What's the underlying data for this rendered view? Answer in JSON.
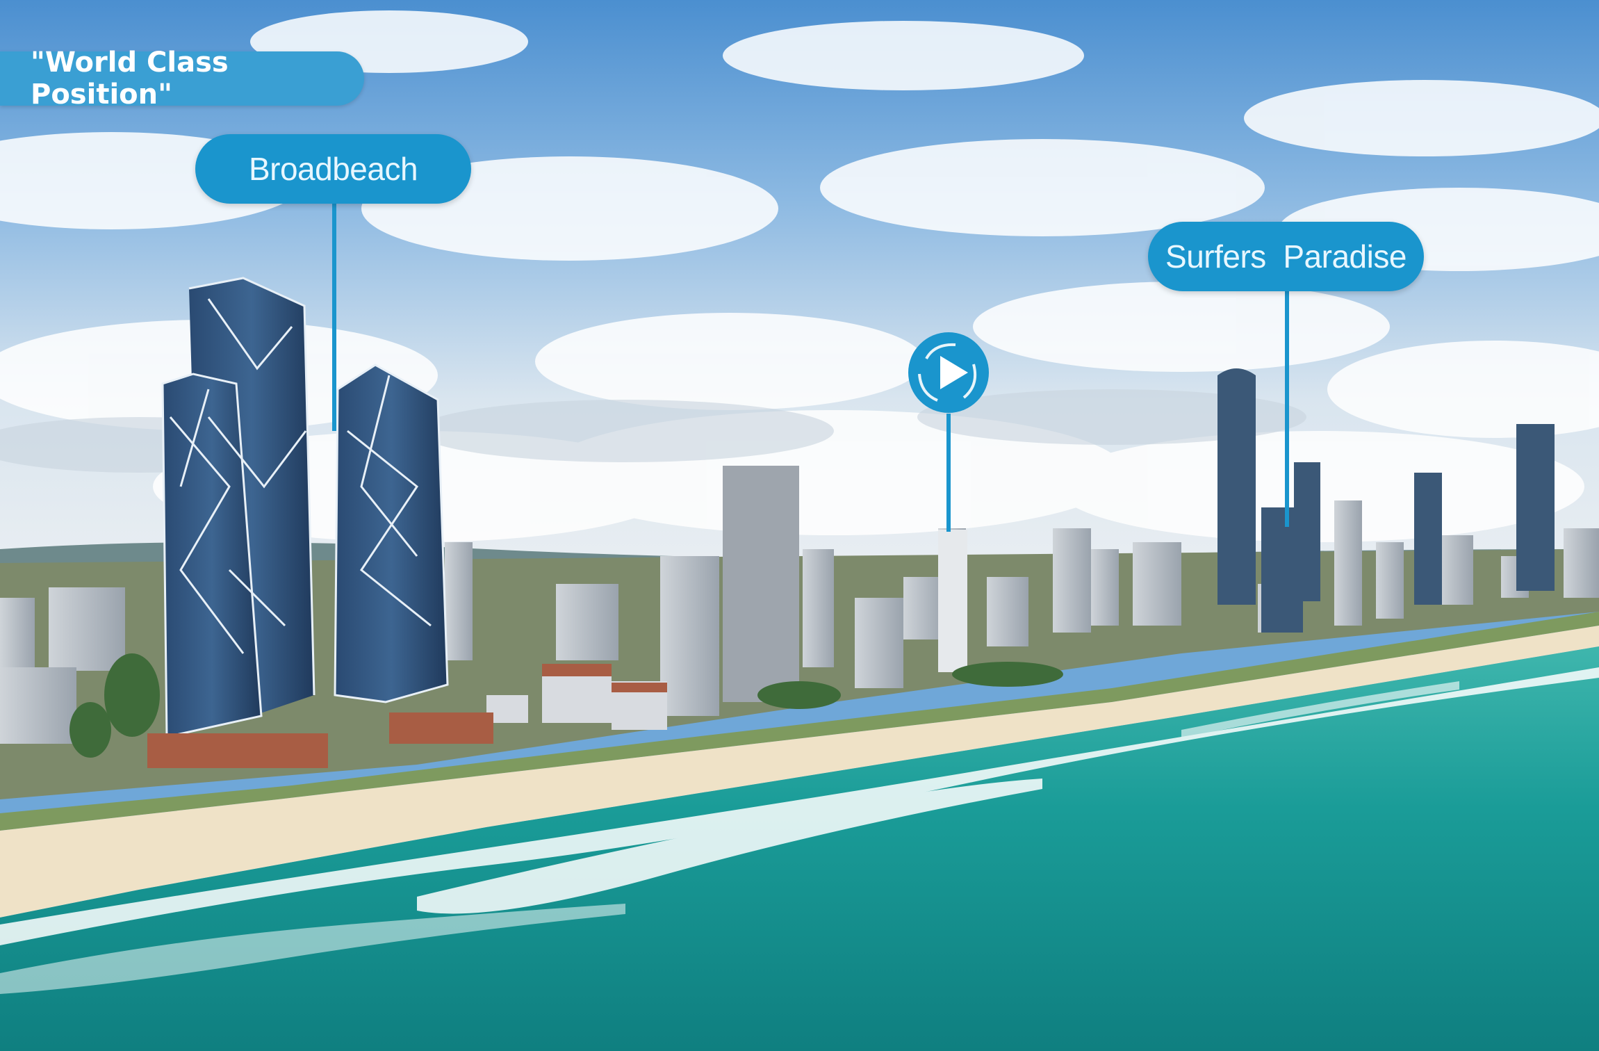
{
  "banner": {
    "title": "\"World Class Position\""
  },
  "markers": {
    "broadbeach": {
      "label": "Broadbeach"
    },
    "surfers": {
      "label": "Surfers  Paradise"
    },
    "video": {
      "icon": "play-icon"
    }
  },
  "colors": {
    "banner_bg": "#3a9fd3",
    "marker_bg": "#1a95cd",
    "sky_top": "#4f93d3",
    "ocean": "#1aa5a0",
    "sand": "#efe2c7"
  }
}
